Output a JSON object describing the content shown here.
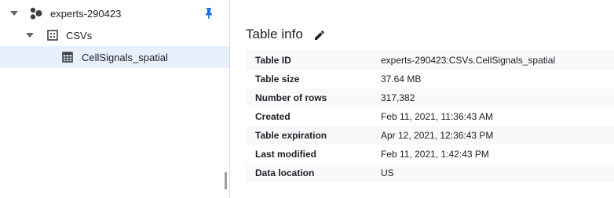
{
  "explorer": {
    "project": {
      "label": "experts-290423",
      "icon": "project-nodes-icon",
      "pinned": true
    },
    "dataset": {
      "label": "CSVs",
      "icon": "dataset-icon"
    },
    "table": {
      "label": "CellSignals_spatial",
      "icon": "table-icon",
      "selected": true
    }
  },
  "details": {
    "section_title": "Table info",
    "rows": [
      {
        "key": "Table ID",
        "value": "experts-290423:CSVs.CellSignals_spatial"
      },
      {
        "key": "Table size",
        "value": "37.64 MB"
      },
      {
        "key": "Number of rows",
        "value": "317,382"
      },
      {
        "key": "Created",
        "value": "Feb 11, 2021, 11:36:43 AM"
      },
      {
        "key": "Table expiration",
        "value": "Apr 12, 2021, 12:36:43 PM"
      },
      {
        "key": "Last modified",
        "value": "Feb 11, 2021, 1:42:43 PM"
      },
      {
        "key": "Data location",
        "value": "US"
      }
    ]
  },
  "colors": {
    "accent": "#1a73e8",
    "selected_bg": "#e8f0fe",
    "alt_row": "#f8f9fa",
    "divider": "#dadce0"
  }
}
